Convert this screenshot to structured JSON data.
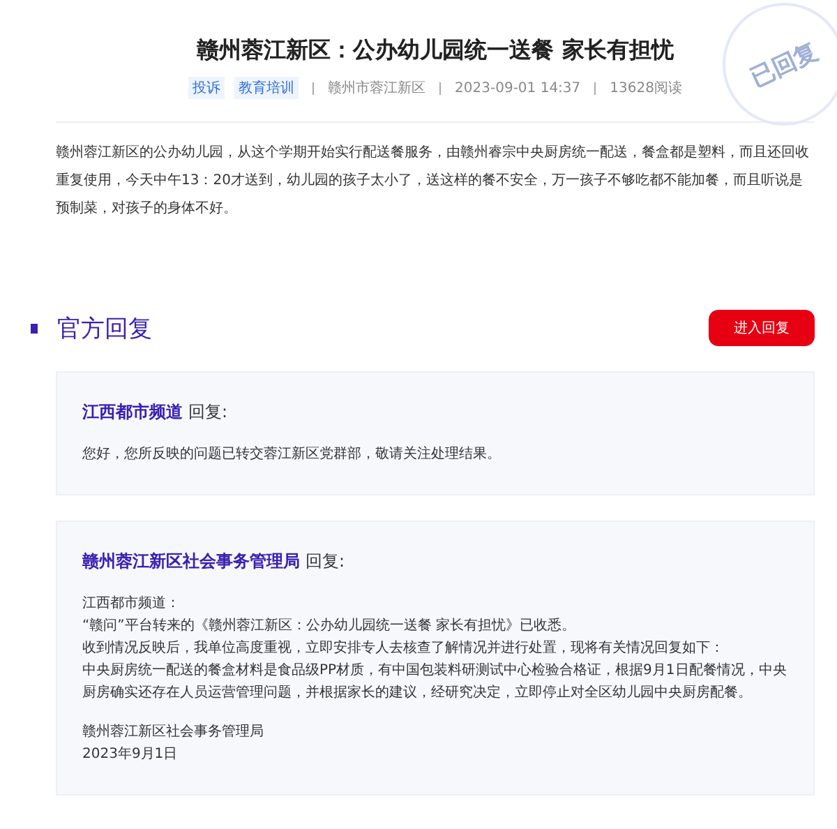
{
  "article": {
    "title": "赣州蓉江新区：公办幼儿园统一送餐 家长有担忧",
    "tags": [
      "投诉",
      "教育培训"
    ],
    "meta": [
      "赣州市蓉江新区",
      "2023-09-01 14:37",
      "13628阅读"
    ],
    "stamp": "已回复",
    "body": "赣州蓉江新区的公办幼儿园，从这个学期开始实行配送餐服务，由赣州睿宗中央厨房统一配送，餐盒都是塑料，而且还回收重复使用，今天中午13：20才送到，幼儿园的孩子太小了，送这样的餐不安全，万一孩子不够吃都不能加餐，而且听说是预制菜，对孩子的身体不好。"
  },
  "replies_section": {
    "title": "官方回复",
    "button": "进入回复",
    "replies": [
      {
        "author": "江西都市频道",
        "suffix": "回复:",
        "paragraphs": [
          "您好，您所反映的问题已转交蓉江新区党群部，敬请关注处理结果。"
        ]
      },
      {
        "author": "赣州蓉江新区社会事务管理局",
        "suffix": "回复:",
        "paragraphs": [
          "江西都市频道：",
          "“赣问”平台转来的《赣州蓉江新区：公办幼儿园统一送餐 家长有担忧》已收悉。",
          "收到情况反映后，我单位高度重视，立即安排专人去核查了解情况并进行处置，现将有关情况回复如下：",
          "中央厨房统一配送的餐盒材料是食品级PP材质，有中国包装料研测试中心检验合格证，根据9月1日配餐情况，中央厨房确实还存在人员运营管理问题，并根据家长的建议，经研究决定，立即停止对全区幼儿园中央厨房配餐。"
        ],
        "signature": [
          "赣州蓉江新区社会事务管理局",
          "2023年9月1日"
        ]
      }
    ]
  }
}
